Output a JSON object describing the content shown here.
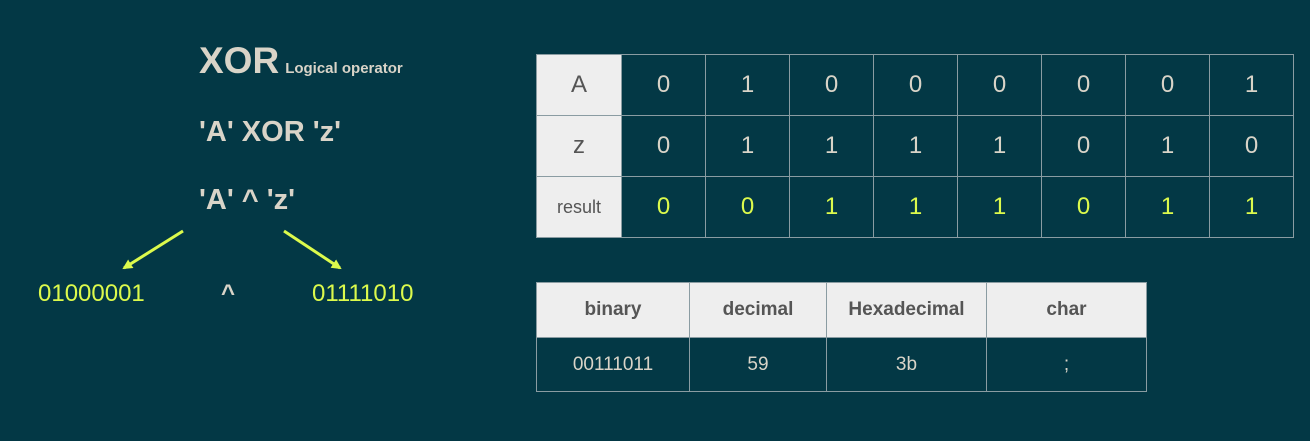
{
  "title": {
    "main": "XOR",
    "sub": "Logical operator"
  },
  "expr_words": "'A' XOR 'z'",
  "expr_symbol": "'A' ^ 'z'",
  "binary_left": "01000001",
  "binary_op": "^",
  "binary_right": "01111010",
  "colors": {
    "background": "#033845",
    "text": "#d9d4c8",
    "highlight": "#dcfa4c",
    "header_bg": "#eeeeee"
  },
  "bits_table": {
    "rows": [
      {
        "label": "A",
        "bits": [
          "0",
          "1",
          "0",
          "0",
          "0",
          "0",
          "0",
          "1"
        ]
      },
      {
        "label": "z",
        "bits": [
          "0",
          "1",
          "1",
          "1",
          "1",
          "0",
          "1",
          "0"
        ]
      },
      {
        "label": "result",
        "bits": [
          "0",
          "0",
          "1",
          "1",
          "1",
          "0",
          "1",
          "1"
        ]
      }
    ]
  },
  "conversion_table": {
    "headers": [
      "binary",
      "decimal",
      "Hexadecimal",
      "char"
    ],
    "row": [
      "00111011",
      "59",
      "3b",
      ";"
    ]
  }
}
